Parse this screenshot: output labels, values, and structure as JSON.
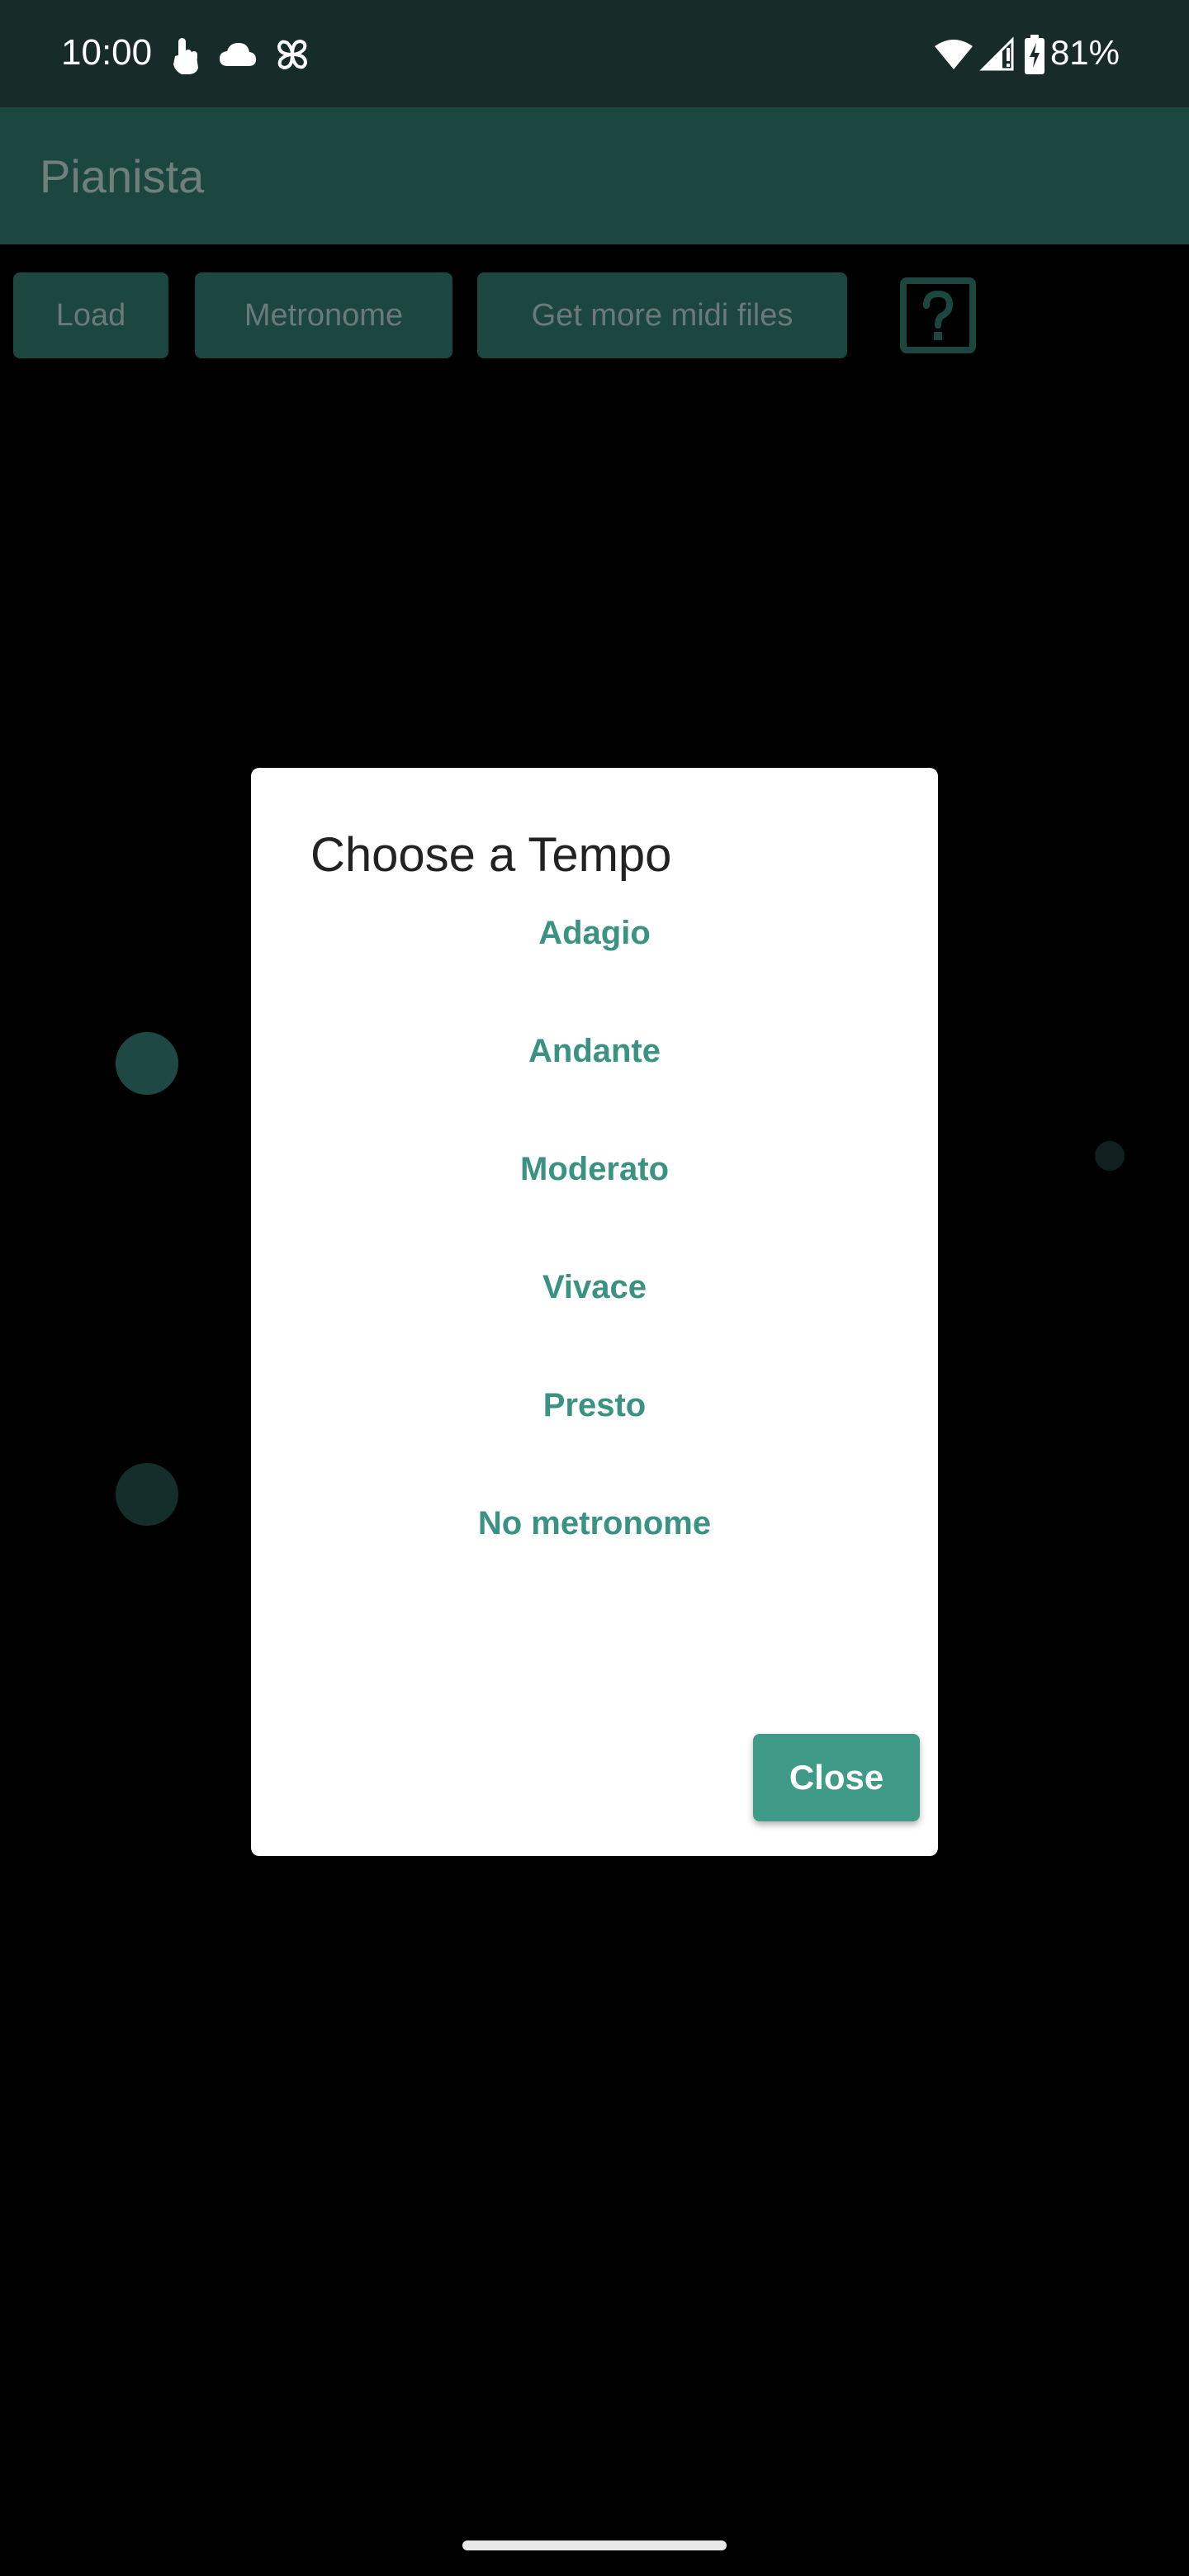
{
  "status_bar": {
    "time": "10:00",
    "battery_percent": "81%",
    "icons": [
      "touch-icon",
      "cloud-icon",
      "pinwheel-icon",
      "wifi-icon",
      "signal-icon",
      "battery-charging-icon"
    ]
  },
  "app_bar": {
    "title": "Pianista"
  },
  "toolbar": {
    "load_label": "Load",
    "metronome_label": "Metronome",
    "get_midi_label": "Get more midi files",
    "help_icon": "help-icon"
  },
  "dialog": {
    "title": "Choose a Tempo",
    "options": [
      {
        "label": "Adagio"
      },
      {
        "label": "Andante"
      },
      {
        "label": "Moderato"
      },
      {
        "label": "Vivace"
      },
      {
        "label": "Presto"
      },
      {
        "label": "No metronome"
      }
    ],
    "close_label": "Close"
  },
  "colors": {
    "status_bar_bg": "#172c28",
    "app_bar_bg": "#1c4640",
    "accent": "#3a9282",
    "close_button_bg": "#3f9a88",
    "background": "#000000"
  }
}
